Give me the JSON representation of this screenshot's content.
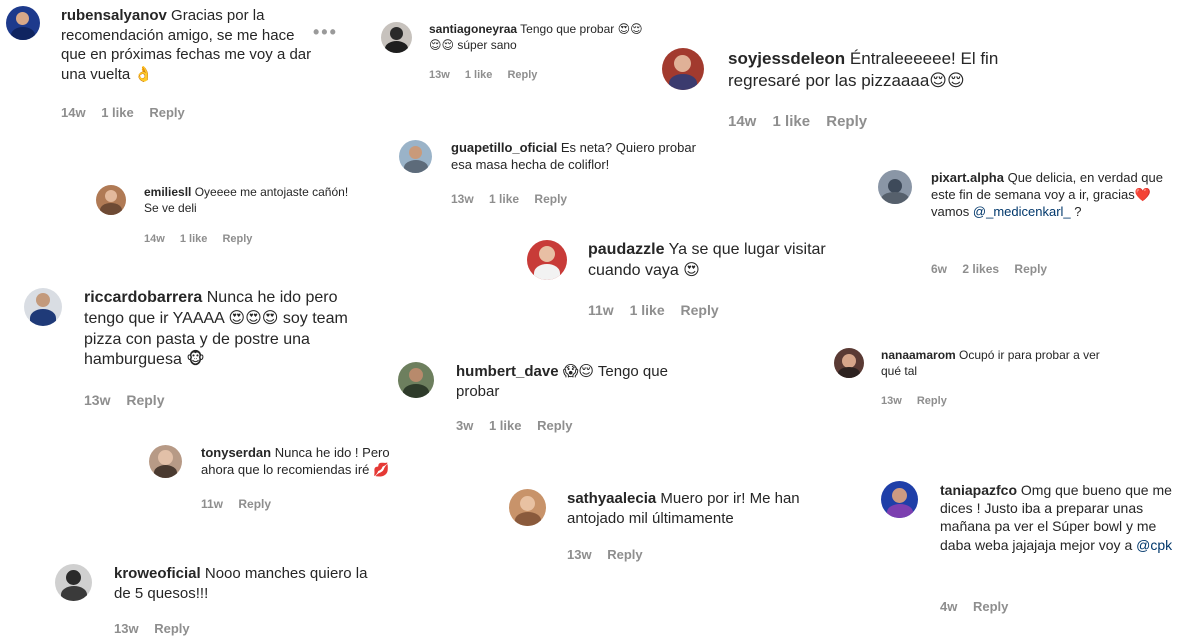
{
  "more_icon": "•••",
  "comments": [
    {
      "user": "rubensalyanov",
      "text": "Gracias por la recomendación amigo, se me hace que en próximas fechas me voy a dar una vuelta 👌",
      "time": "14w",
      "likes": "1 like",
      "reply": "Reply"
    },
    {
      "user": "santiagoneyraa",
      "text": "Tengo que probar 😍😌😌😌 súper sano",
      "time": "13w",
      "likes": "1 like",
      "reply": "Reply"
    },
    {
      "user": "soyjessdeleon",
      "text": "Éntraleeeeee! El fin regresaré por las pizzaaaa😌😌",
      "time": "14w",
      "likes": "1 like",
      "reply": "Reply"
    },
    {
      "user": "guapetillo_oficial",
      "text": "Es neta? Quiero probar esa masa hecha de coliflor!",
      "time": "13w",
      "likes": "1 like",
      "reply": "Reply"
    },
    {
      "user": "emiliesll",
      "text": "Oyeeee me antojaste cañón! Se ve deli",
      "time": "14w",
      "likes": "1 like",
      "reply": "Reply"
    },
    {
      "user": "pixart.alpha",
      "text": "Que delicia, en verdad que este fin de semana voy a ir, gracias❤️ vamos",
      "mention": "@_medicenkarl_",
      "after": " ?",
      "time": "6w",
      "likes": "2 likes",
      "reply": "Reply"
    },
    {
      "user": "paudazzle",
      "text": "Ya se que lugar visitar cuando vaya 😍",
      "time": "11w",
      "likes": "1 like",
      "reply": "Reply"
    },
    {
      "user": "riccardobarrera",
      "text": "Nunca he ido pero tengo que ir YAAAA 😍😍😍 soy team pizza con pasta y de postre una hamburguesa 🐵",
      "time": "13w",
      "reply": "Reply"
    },
    {
      "user": "nanaamarom",
      "text": "Ocupó ir para probar a ver qué tal",
      "time": "13w",
      "reply": "Reply"
    },
    {
      "user": "humbert_dave",
      "text": "😱😌 Tengo que probar",
      "time": "3w",
      "likes": "1 like",
      "reply": "Reply"
    },
    {
      "user": "tonyserdan",
      "text": "Nunca he ido ! Pero ahora que lo recomiendas iré 💋",
      "time": "11w",
      "reply": "Reply"
    },
    {
      "user": "sathyaalecia",
      "text": "Muero por ir! Me han antojado mil últimamente",
      "time": "13w",
      "reply": "Reply"
    },
    {
      "user": "taniapazfco",
      "text": "Omg que bueno que me dices ! Justo iba a preparar unas mañana pa ver el Súper bowl y me daba weba jajajaja mejor voy a",
      "mention": "@cpk",
      "after": "",
      "time": "4w",
      "reply": "Reply"
    },
    {
      "user": "kroweoficial",
      "text": "Nooo manches quiero la de 5 quesos!!!",
      "time": "13w",
      "reply": "Reply"
    }
  ],
  "colors": {
    "username": "#262626",
    "meta": "#8e8e8e",
    "mention": "#00376b",
    "background": "#ffffff"
  }
}
